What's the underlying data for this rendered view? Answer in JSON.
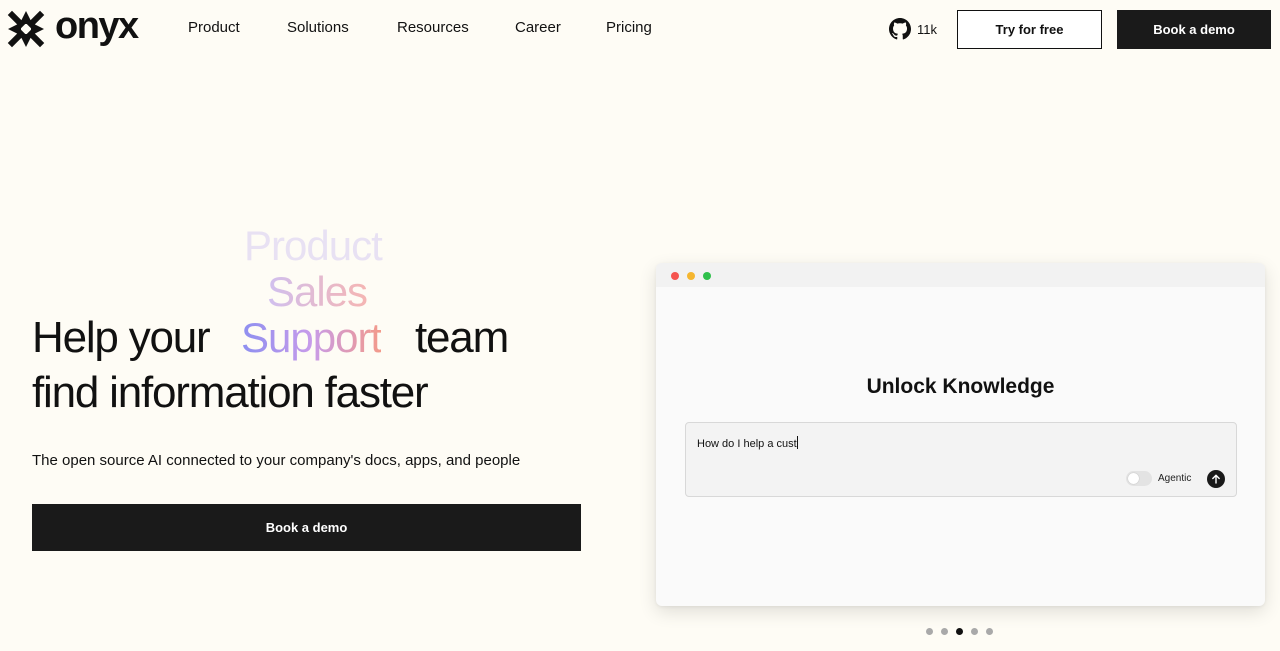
{
  "brand": {
    "name": "onyx"
  },
  "nav": {
    "links": [
      {
        "label": "Product"
      },
      {
        "label": "Solutions"
      },
      {
        "label": "Resources"
      },
      {
        "label": "Career"
      },
      {
        "label": "Pricing"
      }
    ],
    "github": {
      "icon": "github-icon",
      "count": "11k"
    },
    "try_label": "Try for free",
    "demo_label": "Book a demo"
  },
  "hero": {
    "rotating_words": [
      "Product",
      "Sales",
      "Support"
    ],
    "line1_start": "Help your",
    "line1_end": "team",
    "line2": "find information faster",
    "subtitle": "The open source AI connected to your company's docs, apps, and people",
    "cta_label": "Book a demo"
  },
  "app_window": {
    "title": "Unlock Knowledge",
    "input_value": "How do I help a cust",
    "toggle_label": "Agentic",
    "toggle_on": false
  },
  "pagination": {
    "count": 5,
    "active_index": 2
  },
  "colors": {
    "background": "#fefcf5",
    "dark_button": "#1a1a1a",
    "traffic_red": "#f5544f",
    "traffic_yellow": "#f5b630",
    "traffic_green": "#2fc04b"
  }
}
